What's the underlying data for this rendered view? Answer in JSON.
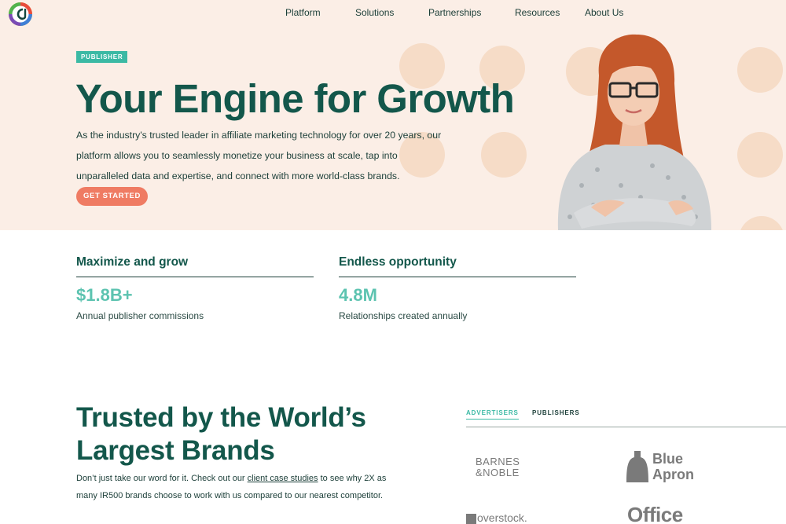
{
  "nav": {
    "items": [
      "Platform",
      "Solutions",
      "Partnerships",
      "Resources",
      "About Us"
    ]
  },
  "hero": {
    "badge": "PUBLISHER",
    "title": "Your Engine for Growth",
    "description": "As the industry's trusted leader in affiliate marketing technology for over 20 years, our platform allows you to seamlessly monetize your business at scale, tap into unparalleled data and expertise, and connect with more world-class brands.",
    "cta": "GET STARTED"
  },
  "stats": [
    {
      "heading": "Maximize and grow",
      "value": "$1.8B+",
      "label": "Annual publisher commissions"
    },
    {
      "heading": "Endless opportunity",
      "value": "4.8M",
      "label": "Relationships created annually"
    }
  ],
  "trusted": {
    "title": "Trusted by the World’s Largest Brands",
    "desc_before": "Don’t just take our word for it. Check out our ",
    "desc_link": "client case studies",
    "desc_after": " to see why 2X as many IR500 brands choose to work with us compared to our nearest competitor.",
    "tabs": [
      {
        "label": "ADVERTISERS",
        "active": true
      },
      {
        "label": "PUBLISHERS",
        "active": false
      }
    ],
    "brands": {
      "barnes_line1": "BARNES",
      "barnes_line2": "&NOBLE",
      "blue_line1": "Blue",
      "blue_line2": "Apron",
      "overstock": "overstock.",
      "office": "Office"
    }
  },
  "colors": {
    "hero_bg": "#fbeee6",
    "dark_green": "#13574b",
    "teal": "#3bb9a4",
    "coral": "#ef7b63"
  }
}
